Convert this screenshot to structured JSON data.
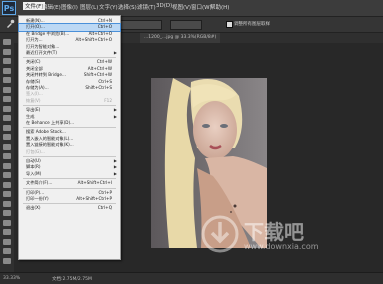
{
  "menubar": {
    "logo": "Ps",
    "items": [
      "文件(F)",
      "编辑(E)",
      "图像(I)",
      "图层(L)",
      "文字(Y)",
      "选择(S)",
      "滤镜(T)",
      "3D(D)",
      "视图(V)",
      "窗口(W)",
      "帮助(H)"
    ]
  },
  "options": {
    "checkbox_label": "调整所有图层取样"
  },
  "tab": {
    "title": "...1200_...jpg @ 33.3%(RGB/8#)"
  },
  "file_menu": {
    "items": [
      {
        "label": "新建(N)...",
        "shortcut": "Ctrl+N"
      },
      {
        "label": "打开(O)...",
        "shortcut": "Ctrl+O",
        "highlight": true
      },
      {
        "label": "在 Bridge 中浏览(B)...",
        "shortcut": "Alt+Ctrl+O"
      },
      {
        "label": "打开为...",
        "shortcut": "Alt+Shift+Ctrl+O"
      },
      {
        "label": "打开为智能对象...",
        "shortcut": ""
      },
      {
        "label": "最近打开文件(T)",
        "shortcut": "",
        "submenu": true
      },
      {
        "sep": true
      },
      {
        "label": "关闭(C)",
        "shortcut": "Ctrl+W"
      },
      {
        "label": "关闭全部",
        "shortcut": "Alt+Ctrl+W"
      },
      {
        "label": "关闭并转到 Bridge...",
        "shortcut": "Shift+Ctrl+W"
      },
      {
        "label": "存储(S)",
        "shortcut": "Ctrl+S"
      },
      {
        "label": "存储为(A)...",
        "shortcut": "Shift+Ctrl+S"
      },
      {
        "label": "签入(I)...",
        "shortcut": "",
        "disabled": true
      },
      {
        "label": "恢复(V)",
        "shortcut": "F12",
        "disabled": true
      },
      {
        "sep": true
      },
      {
        "label": "导出(E)",
        "shortcut": "",
        "submenu": true
      },
      {
        "label": "生成",
        "shortcut": "",
        "submenu": true
      },
      {
        "label": "在 Behance 上共享(D)...",
        "shortcut": ""
      },
      {
        "sep": true
      },
      {
        "label": "搜索 Adobe Stock...",
        "shortcut": ""
      },
      {
        "label": "置入嵌入的智能对象(L)...",
        "shortcut": ""
      },
      {
        "label": "置入链接的智能对象(K)...",
        "shortcut": ""
      },
      {
        "label": "打包(G)...",
        "shortcut": "",
        "disabled": true
      },
      {
        "sep": true
      },
      {
        "label": "自动(U)",
        "shortcut": "",
        "submenu": true
      },
      {
        "label": "脚本(R)",
        "shortcut": "",
        "submenu": true
      },
      {
        "label": "导入(M)",
        "shortcut": "",
        "submenu": true
      },
      {
        "sep": true
      },
      {
        "label": "文件简介(F)...",
        "shortcut": "Alt+Shift+Ctrl+I"
      },
      {
        "sep": true
      },
      {
        "label": "打印(P)...",
        "shortcut": "Ctrl+P"
      },
      {
        "label": "打印一份(Y)",
        "shortcut": "Alt+Shift+Ctrl+P"
      },
      {
        "sep": true
      },
      {
        "label": "退出(X)",
        "shortcut": "Ctrl+Q"
      }
    ]
  },
  "status": {
    "zoom": "33.33%",
    "doc": "文档:2.75M/2.75M"
  },
  "watermark": {
    "text": "下载吧",
    "url": "www.downxia.com"
  }
}
